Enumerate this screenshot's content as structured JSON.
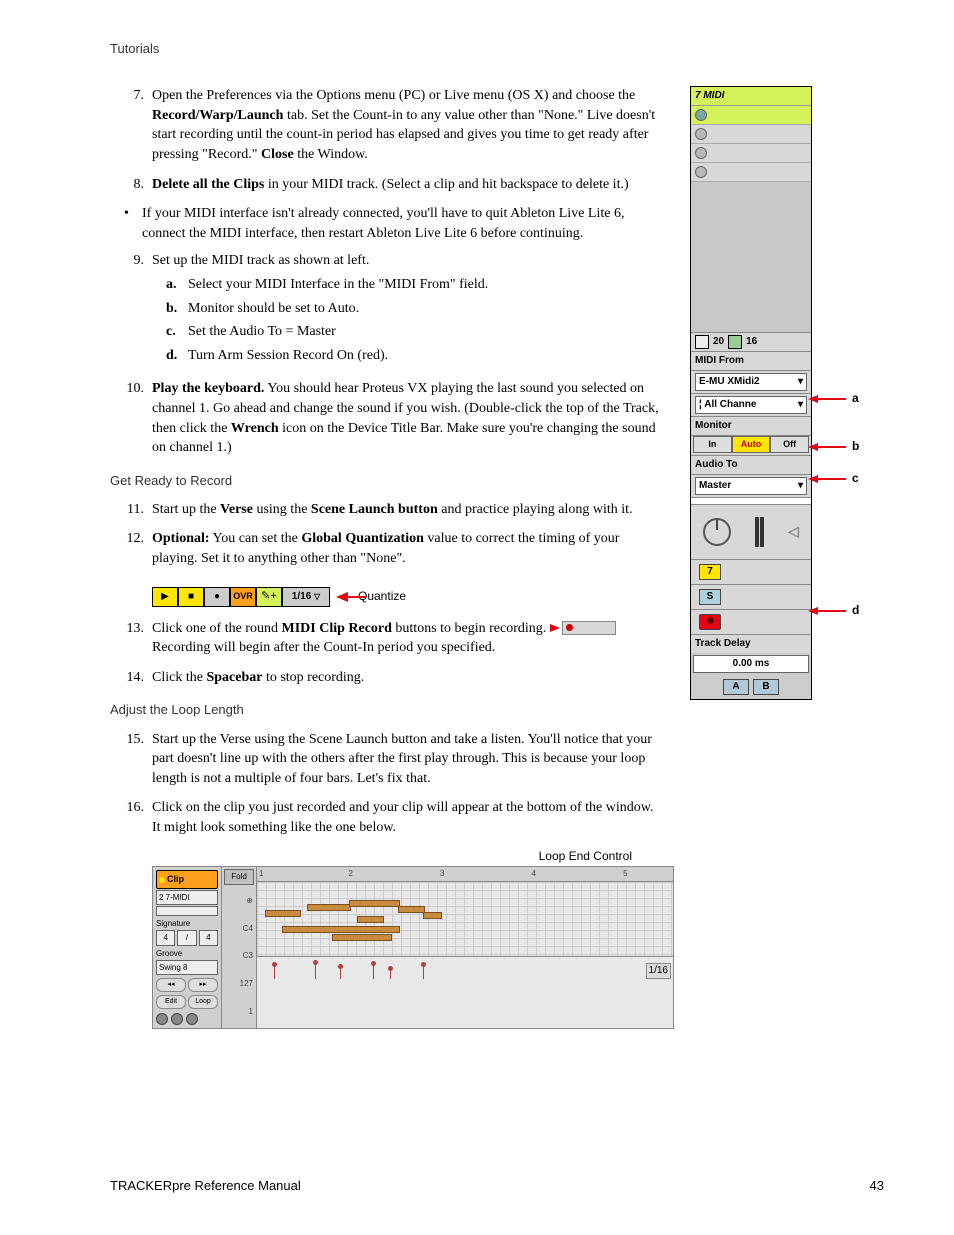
{
  "header": "Tutorials",
  "steps": [
    {
      "n": "7.",
      "html": "Open the Preferences via the Options menu (PC) or Live menu (OS X) and choose the <b>Record/Warp/Launch</b> tab. Set the Count-in to any value other than \"None.\" Live doesn't start recording until the count-in period has elapsed and gives you time to get ready after pressing \"Record.\" <b>Close</b> the Window."
    },
    {
      "n": "8.",
      "html": "<b>Delete all the Clips</b> in your MIDI track. (Select a clip and hit backspace to delete it.)"
    }
  ],
  "bullet": "If your MIDI interface isn't already connected, you'll have to quit Ableton Live Lite 6, connect the MIDI interface, then restart Ableton Live Lite 6 before continuing.",
  "step9": {
    "n": "9.",
    "text": "Set up the MIDI track as shown at left.",
    "subs": [
      {
        "l": "a.",
        "t": "Select your MIDI Interface in the \"MIDI From\" field."
      },
      {
        "l": "b.",
        "t": "Monitor should be set to Auto."
      },
      {
        "l": "c.",
        "t": "Set the Audio To = Master"
      },
      {
        "l": "d.",
        "t": "Turn Arm Session Record On (red)."
      }
    ]
  },
  "step10": {
    "n": "10.",
    "html": "<b>Play the keyboard.</b> You should hear Proteus VX playing the last sound you selected on channel 1. Go ahead and change the sound if you wish. (Double-click the top of the Track, then click the <b>Wrench</b> icon on the Device Title Bar. Make sure you're changing the sound on channel 1.)"
  },
  "section1": "Get Ready to Record",
  "step11": {
    "n": "11.",
    "html": "Start up the <b>Verse</b> using the <b>Scene Launch button</b> and practice playing along with it."
  },
  "step12": {
    "n": "12.",
    "html": "<b>Optional:</b> You can set the <b>Global Quantization</b> value to correct the timing of your playing. Set it to anything other than \"None\"."
  },
  "transport": {
    "ovr": "OVR",
    "quant": "1/16",
    "label": "Quantize"
  },
  "step13": {
    "n": "13.",
    "pre": "Click one of the round <b>MIDI Clip Record</b> buttons to begin recording.",
    "post": "Recording will begin after the Count-In period you specified."
  },
  "step14": {
    "n": "14.",
    "html": "Click the <b>Spacebar</b> to stop recording."
  },
  "section2": "Adjust the Loop Length",
  "step15": {
    "n": "15.",
    "html": "Start up the Verse using the Scene Launch button and take a listen. You'll notice that your part doesn't line up with the others after the first play through. This is because your loop length is not a multiple of four bars. Let's fix that."
  },
  "step16": {
    "n": "16.",
    "html": "Click on the clip you just recorded and your clip will appear at the bottom of the window. It might look something like the one below."
  },
  "loop_label": "Loop End Control",
  "track": {
    "title": "7 MIDI",
    "sends": {
      "a": "20",
      "b": "16"
    },
    "midi_from_label": "MIDI From",
    "midi_from_value": "E-MU XMidi2",
    "channel": "All Channe",
    "monitor_label": "Monitor",
    "monitor": {
      "in": "In",
      "auto": "Auto",
      "off": "Off"
    },
    "audio_to_label": "Audio To",
    "audio_to_value": "Master",
    "num": "7",
    "solo": "S",
    "track_delay_label": "Track Delay",
    "track_delay_value": "0.00 ms",
    "cue_a": "A",
    "cue_b": "B"
  },
  "callouts": {
    "a": "a",
    "b": "b",
    "c": "c",
    "d": "d"
  },
  "clip_editor": {
    "clip_label": "Clip",
    "clip_name": "2 7-MIDI",
    "sig_label": "Signature",
    "sig_a": "4",
    "sig_b": "4",
    "groove_label": "Groove",
    "groove_value": "Swing 8",
    "fold": "Fold",
    "c4": "C4",
    "c3": "C3",
    "vel127": "127",
    "vel1": "1",
    "ruler": [
      "1",
      "2",
      "3",
      "4",
      "5"
    ],
    "frac": "1/16"
  },
  "footer": {
    "left": "TRACKERpre Reference Manual",
    "right": "43"
  }
}
